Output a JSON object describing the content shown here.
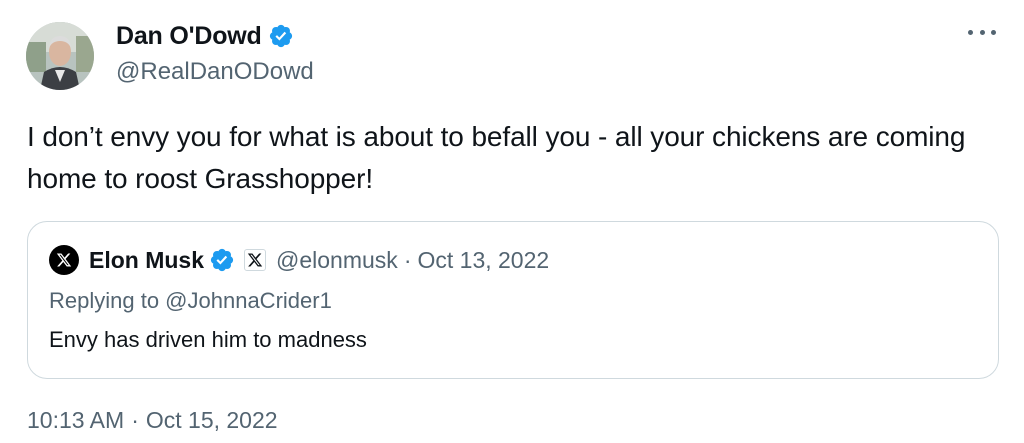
{
  "author": {
    "display_name": "Dan O'Dowd",
    "handle": "@RealDanODowd",
    "avatar_icon": "profile-photo",
    "verified_icon": "verified-badge-icon",
    "verified_color": "#1d9bf0"
  },
  "more_menu_icon": "more-options-icon",
  "tweet": {
    "text": "I don’t envy you for what is about to befall you - all your chickens are coming home to roost Grasshopper!"
  },
  "quoted_tweet": {
    "display_name": "Elon Musk",
    "handle": "@elonmusk",
    "separator": "·",
    "date": "Oct 13, 2022",
    "replying_to": "Replying to @JohnnaCrider1",
    "text": "Envy has driven him to madness",
    "avatar_icon": "x-logo-icon",
    "affiliation_icon": "x-affiliation-icon"
  },
  "timestamp": {
    "time": "10:13 AM",
    "separator": "·",
    "date": "Oct 15, 2022"
  },
  "colors": {
    "text_primary": "#0f1419",
    "text_secondary": "#536471",
    "border": "#cfd9de",
    "verified": "#1d9bf0"
  }
}
